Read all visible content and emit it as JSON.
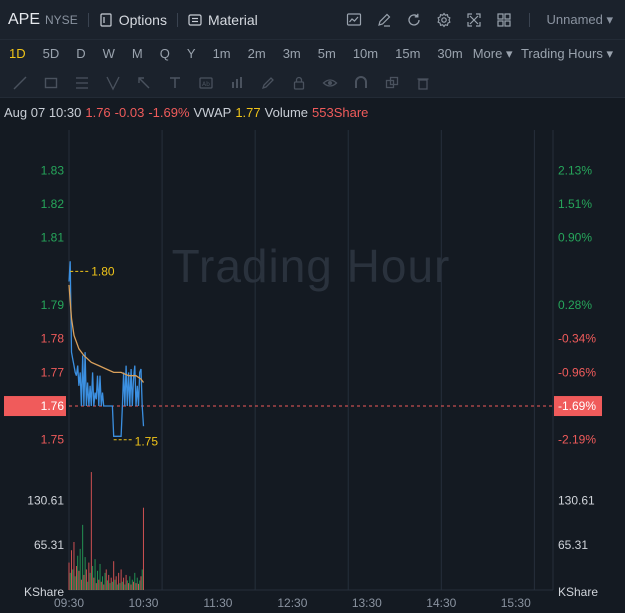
{
  "header": {
    "symbol": "APE",
    "exchange": "NYSE",
    "options_label": "Options",
    "material_label": "Material",
    "layout_name": "Unnamed",
    "icons": [
      "chart-settings-icon",
      "draw-pen-icon",
      "refresh-icon",
      "gear-icon",
      "fullscreen-icon",
      "layout-grid-icon"
    ]
  },
  "timeframes": [
    "1D",
    "5D",
    "D",
    "W",
    "M",
    "Q",
    "Y",
    "1m",
    "2m",
    "3m",
    "5m",
    "10m",
    "15m",
    "30m"
  ],
  "active_timeframe": "1D",
  "more_label": "More",
  "trading_hours_label": "Trading Hours",
  "drawing_tools": [
    "trend-line-icon",
    "rectangle-icon",
    "fibonacci-icon",
    "pitchfork-icon",
    "arrow-icon",
    "text-icon",
    "pattern-icon",
    "measure-icon",
    "pencil-icon",
    "lock-icon",
    "eye-icon",
    "magnet-icon",
    "clone-icon",
    "trash-icon"
  ],
  "info": {
    "date": "Aug 07 10:30",
    "price": "1.76",
    "change": "-0.03",
    "change_pct": "-1.69%",
    "vwap_label": "VWAP",
    "vwap": "1.77",
    "volume_label": "Volume",
    "volume": "553Share"
  },
  "colors": {
    "up": "#26a65b",
    "down": "#f05b5b",
    "price_line": "#3b8fe0",
    "vwap_line": "#d9a05b",
    "accent": "#f0c419"
  },
  "chart_data": {
    "type": "line",
    "watermark": "Trading Hour",
    "y_ticks": [
      1.83,
      1.82,
      1.81,
      1.79,
      1.78,
      1.77,
      1.76,
      1.75
    ],
    "y_tick_labels": [
      "1.83",
      "1.82",
      "1.81",
      "1.79",
      "1.78",
      "1.77",
      "1.76",
      "1.75"
    ],
    "pct_labels": [
      "2.13%",
      "1.51%",
      "0.90%",
      "0.28%",
      "-0.34%",
      "-0.96%",
      "-1.69%",
      "-2.19%"
    ],
    "ylim": [
      1.741,
      1.842
    ],
    "prev_close": 1.79,
    "current_price": 1.76,
    "current_price_label": "1.76",
    "current_pct_label": "-1.69%",
    "x_labels": [
      "09:30",
      "10:30",
      "11:30",
      "12:30",
      "13:30",
      "14:30",
      "15:30"
    ],
    "x_range_minutes": 390,
    "high": {
      "value": 1.8,
      "label": "1.80",
      "minute": 1
    },
    "low": {
      "value": 1.75,
      "label": "1.75",
      "minute": 36
    },
    "price_series": [
      [
        0,
        1.797
      ],
      [
        1,
        1.803
      ],
      [
        2,
        1.776
      ],
      [
        3,
        1.774
      ],
      [
        4,
        1.772
      ],
      [
        5,
        1.77
      ],
      [
        6,
        1.769
      ],
      [
        7,
        1.772
      ],
      [
        8,
        1.766
      ],
      [
        9,
        1.77
      ],
      [
        10,
        1.76
      ],
      [
        11,
        1.775
      ],
      [
        12,
        1.76
      ],
      [
        13,
        1.776
      ],
      [
        14,
        1.76
      ],
      [
        15,
        1.767
      ],
      [
        16,
        1.76
      ],
      [
        17,
        1.766
      ],
      [
        18,
        1.76
      ],
      [
        19,
        1.77
      ],
      [
        20,
        1.76
      ],
      [
        21,
        1.764
      ],
      [
        22,
        1.762
      ],
      [
        23,
        1.769
      ],
      [
        24,
        1.76
      ],
      [
        25,
        1.769
      ],
      [
        26,
        1.76
      ],
      [
        27,
        1.764
      ],
      [
        28,
        1.76
      ],
      [
        29,
        1.76
      ],
      [
        30,
        1.76
      ],
      [
        31,
        1.76
      ],
      [
        32,
        1.76
      ],
      [
        33,
        1.76
      ],
      [
        34,
        1.76
      ],
      [
        35,
        1.76
      ],
      [
        36,
        1.751
      ],
      [
        37,
        1.751
      ],
      [
        38,
        1.751
      ],
      [
        39,
        1.751
      ],
      [
        40,
        1.751
      ],
      [
        41,
        1.751
      ],
      [
        42,
        1.751
      ],
      [
        43,
        1.76
      ],
      [
        44,
        1.77
      ],
      [
        45,
        1.76
      ],
      [
        46,
        1.772
      ],
      [
        47,
        1.76
      ],
      [
        48,
        1.77
      ],
      [
        49,
        1.76
      ],
      [
        50,
        1.771
      ],
      [
        51,
        1.76
      ],
      [
        52,
        1.768
      ],
      [
        53,
        1.772
      ],
      [
        54,
        1.76
      ],
      [
        55,
        1.766
      ],
      [
        56,
        1.76
      ],
      [
        57,
        1.77
      ],
      [
        58,
        1.771
      ],
      [
        59,
        1.76
      ],
      [
        60,
        1.754
      ]
    ],
    "vwap_series": [
      [
        0,
        1.796
      ],
      [
        2,
        1.786
      ],
      [
        4,
        1.781
      ],
      [
        8,
        1.777
      ],
      [
        12,
        1.775
      ],
      [
        18,
        1.773
      ],
      [
        24,
        1.772
      ],
      [
        30,
        1.771
      ],
      [
        36,
        1.77
      ],
      [
        42,
        1.77
      ],
      [
        48,
        1.769
      ],
      [
        54,
        1.769
      ],
      [
        58,
        1.768
      ],
      [
        60,
        1.767
      ]
    ],
    "volume_ticks": [
      130.61,
      65.31
    ],
    "volume_tick_labels": [
      "130.61",
      "65.31"
    ],
    "volume_unit": "KShare",
    "volume_max": 175,
    "volumes": [
      [
        0,
        40,
        "d"
      ],
      [
        1,
        25,
        "u"
      ],
      [
        2,
        58,
        "d"
      ],
      [
        3,
        30,
        "u"
      ],
      [
        4,
        70,
        "d"
      ],
      [
        5,
        20,
        "u"
      ],
      [
        6,
        35,
        "d"
      ],
      [
        7,
        50,
        "u"
      ],
      [
        8,
        28,
        "d"
      ],
      [
        9,
        60,
        "u"
      ],
      [
        10,
        15,
        "d"
      ],
      [
        11,
        95,
        "u"
      ],
      [
        12,
        22,
        "d"
      ],
      [
        13,
        48,
        "u"
      ],
      [
        14,
        30,
        "d"
      ],
      [
        15,
        12,
        "u"
      ],
      [
        16,
        40,
        "d"
      ],
      [
        17,
        25,
        "u"
      ],
      [
        18,
        172,
        "d"
      ],
      [
        19,
        35,
        "u"
      ],
      [
        20,
        18,
        "d"
      ],
      [
        21,
        45,
        "u"
      ],
      [
        22,
        10,
        "d"
      ],
      [
        23,
        28,
        "u"
      ],
      [
        24,
        15,
        "d"
      ],
      [
        25,
        38,
        "u"
      ],
      [
        26,
        12,
        "d"
      ],
      [
        27,
        20,
        "u"
      ],
      [
        28,
        8,
        "d"
      ],
      [
        29,
        25,
        "u"
      ],
      [
        30,
        30,
        "d"
      ],
      [
        31,
        14,
        "u"
      ],
      [
        32,
        22,
        "d"
      ],
      [
        33,
        10,
        "u"
      ],
      [
        34,
        18,
        "d"
      ],
      [
        35,
        12,
        "u"
      ],
      [
        36,
        42,
        "d"
      ],
      [
        37,
        15,
        "u"
      ],
      [
        38,
        20,
        "d"
      ],
      [
        39,
        8,
        "u"
      ],
      [
        40,
        25,
        "d"
      ],
      [
        41,
        10,
        "u"
      ],
      [
        42,
        30,
        "d"
      ],
      [
        43,
        12,
        "u"
      ],
      [
        44,
        18,
        "d"
      ],
      [
        45,
        8,
        "u"
      ],
      [
        46,
        22,
        "d"
      ],
      [
        47,
        14,
        "u"
      ],
      [
        48,
        10,
        "d"
      ],
      [
        49,
        20,
        "u"
      ],
      [
        50,
        8,
        "d"
      ],
      [
        51,
        15,
        "u"
      ],
      [
        52,
        12,
        "d"
      ],
      [
        53,
        25,
        "u"
      ],
      [
        54,
        10,
        "d"
      ],
      [
        55,
        18,
        "u"
      ],
      [
        56,
        9,
        "d"
      ],
      [
        57,
        14,
        "u"
      ],
      [
        58,
        20,
        "d"
      ],
      [
        59,
        30,
        "u"
      ],
      [
        60,
        120,
        "d"
      ]
    ]
  }
}
